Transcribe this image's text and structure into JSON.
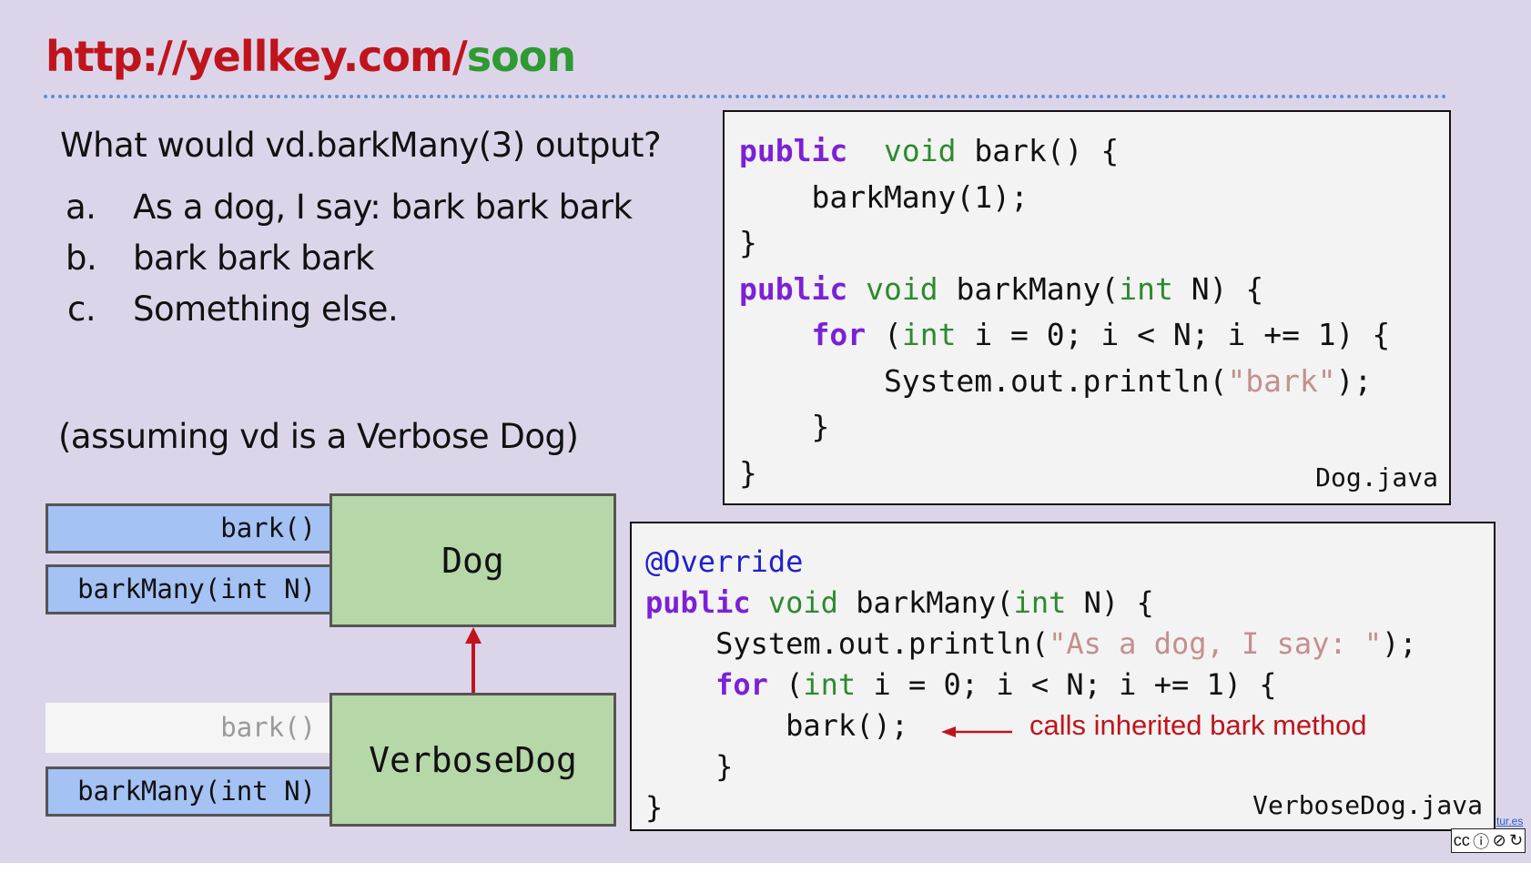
{
  "title": {
    "part1": "http://yellkey.com/",
    "part2": "soon"
  },
  "question": "What would vd.barkMany(3) output?",
  "options": [
    {
      "label": "a.",
      "text": "As a dog, I say: bark bark bark"
    },
    {
      "label": "b.",
      "text": "bark bark bark"
    },
    {
      "label": "c.",
      "text": "Something else."
    }
  ],
  "assumption": "(assuming vd is a Verbose Dog)",
  "dog_code": {
    "filename": "Dog.java",
    "lines": [
      [
        [
          "kw",
          "public"
        ],
        [
          "",
          "  "
        ],
        [
          "ty",
          "void"
        ],
        [
          "",
          " bark() {"
        ]
      ],
      [
        [
          "",
          "    barkMany(1);"
        ]
      ],
      [
        [
          "",
          "}"
        ]
      ],
      [
        [
          "kw",
          "public"
        ],
        [
          "",
          " "
        ],
        [
          "ty",
          "void"
        ],
        [
          "",
          " barkMany("
        ],
        [
          "ty",
          "int"
        ],
        [
          "",
          " N) {"
        ]
      ],
      [
        [
          "",
          "    "
        ],
        [
          "kw",
          "for"
        ],
        [
          "",
          " ("
        ],
        [
          "ty",
          "int"
        ],
        [
          "",
          " i = 0; i < N; i += 1) {"
        ]
      ],
      [
        [
          "",
          "        System.out.println("
        ],
        [
          "st",
          "\"bark\""
        ],
        [
          "",
          ");"
        ]
      ],
      [
        [
          "",
          "    }"
        ]
      ],
      [
        [
          "",
          "}"
        ]
      ]
    ]
  },
  "verbose_code": {
    "filename": "VerboseDog.java",
    "lines": [
      [
        [
          "an",
          "@Override"
        ]
      ],
      [
        [
          "kw",
          "public"
        ],
        [
          "",
          " "
        ],
        [
          "ty",
          "void"
        ],
        [
          "",
          " barkMany("
        ],
        [
          "ty",
          "int"
        ],
        [
          "",
          " N) {"
        ]
      ],
      [
        [
          "",
          "    System.out.println("
        ],
        [
          "st",
          "\"As a dog, I say: \""
        ],
        [
          "",
          ");"
        ]
      ],
      [
        [
          "",
          "    "
        ],
        [
          "kw",
          "for"
        ],
        [
          "",
          " ("
        ],
        [
          "ty",
          "int"
        ],
        [
          "",
          " i = 0; i < N; i += 1) {"
        ]
      ],
      [
        [
          "",
          "        bark();"
        ]
      ],
      [
        [
          "",
          "    }"
        ]
      ],
      [
        [
          "",
          "}"
        ]
      ]
    ],
    "annotation": "calls inherited bark method"
  },
  "diagram": {
    "dog": {
      "name": "Dog",
      "methods": [
        "bark()",
        "barkMany(int N)"
      ]
    },
    "verbose": {
      "name": "VerboseDog",
      "methods": [
        "bark()",
        "barkMany(int N)"
      ],
      "inherited_method": "bark()"
    }
  },
  "footer": {
    "link_text": "tur.es",
    "license_label": "cc"
  }
}
